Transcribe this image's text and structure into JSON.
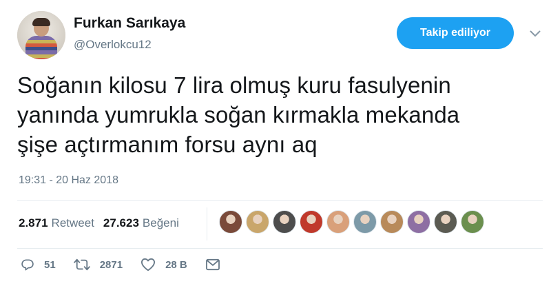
{
  "user": {
    "name": "Furkan Sarıkaya",
    "handle": "@Overlokcu12"
  },
  "follow_button": {
    "label": "Takip ediliyor"
  },
  "tweet": {
    "lines": [
      "Soğanın kilosu 7 lira olmuş kuru fasulyenin",
      "yanında yumrukla soğan kırmakla mekanda",
      "şişe açtırmanım forsu aynı aq"
    ],
    "timestamp": "19:31 - 20 Haz 2018"
  },
  "stats": {
    "retweets": {
      "count": "2.871",
      "label": "Retweet"
    },
    "likes": {
      "count": "27.623",
      "label": "Beğeni"
    }
  },
  "likers": [
    {
      "icon": "liker-avatar-1",
      "color": "#7a4a3a"
    },
    {
      "icon": "liker-avatar-2",
      "color": "#c9a66b"
    },
    {
      "icon": "liker-avatar-3",
      "color": "#4d4d4d"
    },
    {
      "icon": "liker-avatar-4",
      "color": "#c0392b"
    },
    {
      "icon": "liker-avatar-5",
      "color": "#d9a07a"
    },
    {
      "icon": "liker-avatar-6",
      "color": "#7d9aa8"
    },
    {
      "icon": "liker-avatar-7",
      "color": "#b88a5a"
    },
    {
      "icon": "liker-avatar-8",
      "color": "#8e6fa3"
    },
    {
      "icon": "liker-avatar-9",
      "color": "#5b5b52"
    },
    {
      "icon": "liker-avatar-10",
      "color": "#6b8f4e"
    }
  ],
  "actions": {
    "reply": {
      "icon": "reply-icon",
      "count": "51"
    },
    "retweet": {
      "icon": "retweet-icon",
      "count": "2871"
    },
    "like": {
      "icon": "heart-icon",
      "count": "28 B"
    },
    "dm": {
      "icon": "mail-icon"
    }
  },
  "colors": {
    "accent": "#1da1f2",
    "text": "#14171a",
    "muted": "#657786"
  }
}
